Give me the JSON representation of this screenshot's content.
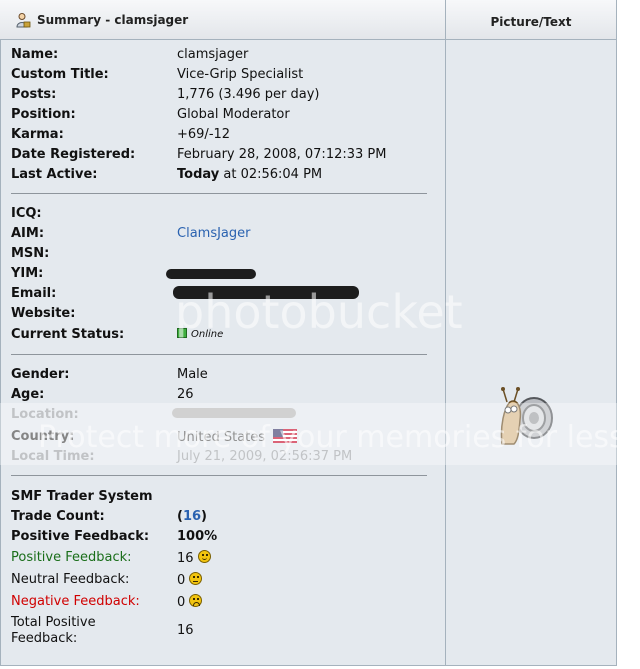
{
  "header": {
    "title": "Summary - clamsjager",
    "right_title": "Picture/Text"
  },
  "summary": [
    {
      "label": "Name:",
      "value": "clamsjager"
    },
    {
      "label": "Custom Title:",
      "value": "Vice-Grip Specialist"
    },
    {
      "label": "Posts:",
      "value": "1,776 (3.496 per day)"
    },
    {
      "label": "Position:",
      "value": "Global Moderator"
    },
    {
      "label": "Karma:",
      "value": "+69/-12"
    },
    {
      "label": "Date Registered:",
      "value": "February 28, 2008, 07:12:33 PM"
    },
    {
      "label": "Last Active:",
      "value_bold": "Today",
      "value": " at 02:56:04 PM"
    }
  ],
  "contact": {
    "icq": "ICQ:",
    "aim": "AIM:",
    "aim_value": "ClamsJager",
    "msn": "MSN:",
    "yim": "YIM:",
    "email": "Email:",
    "website": "Website:",
    "status": "Current Status:",
    "status_value": "Online"
  },
  "personal": {
    "gender": "Gender:",
    "gender_value": "Male",
    "age": "Age:",
    "age_value": "26",
    "location": "Location:",
    "country": "Country:",
    "country_value": "United States",
    "local_time": "Local Time:",
    "local_time_value": "July 21, 2009, 02:56:37 PM"
  },
  "trader": {
    "heading": "SMF Trader System",
    "trade_count": "Trade Count:",
    "trade_count_open": "(",
    "trade_count_value": "16",
    "trade_count_close": ")",
    "positive_pct": "Positive Feedback:",
    "positive_pct_value": "100%",
    "positive": "Positive Feedback:",
    "positive_value": "16",
    "neutral": "Neutral Feedback:",
    "neutral_value": "0",
    "negative": "Negative Feedback:",
    "negative_value": "0",
    "total_l1": "Total Positive",
    "total_l2": "Feedback:",
    "total_value": "16"
  },
  "watermark": {
    "line1": "photobucket",
    "line2": "Protect more of your memories for less!"
  },
  "colors": {
    "link": "#2a62b0",
    "positive": "#1a6e1a",
    "negative": "#d00000",
    "panel": "#e4e9ee"
  }
}
